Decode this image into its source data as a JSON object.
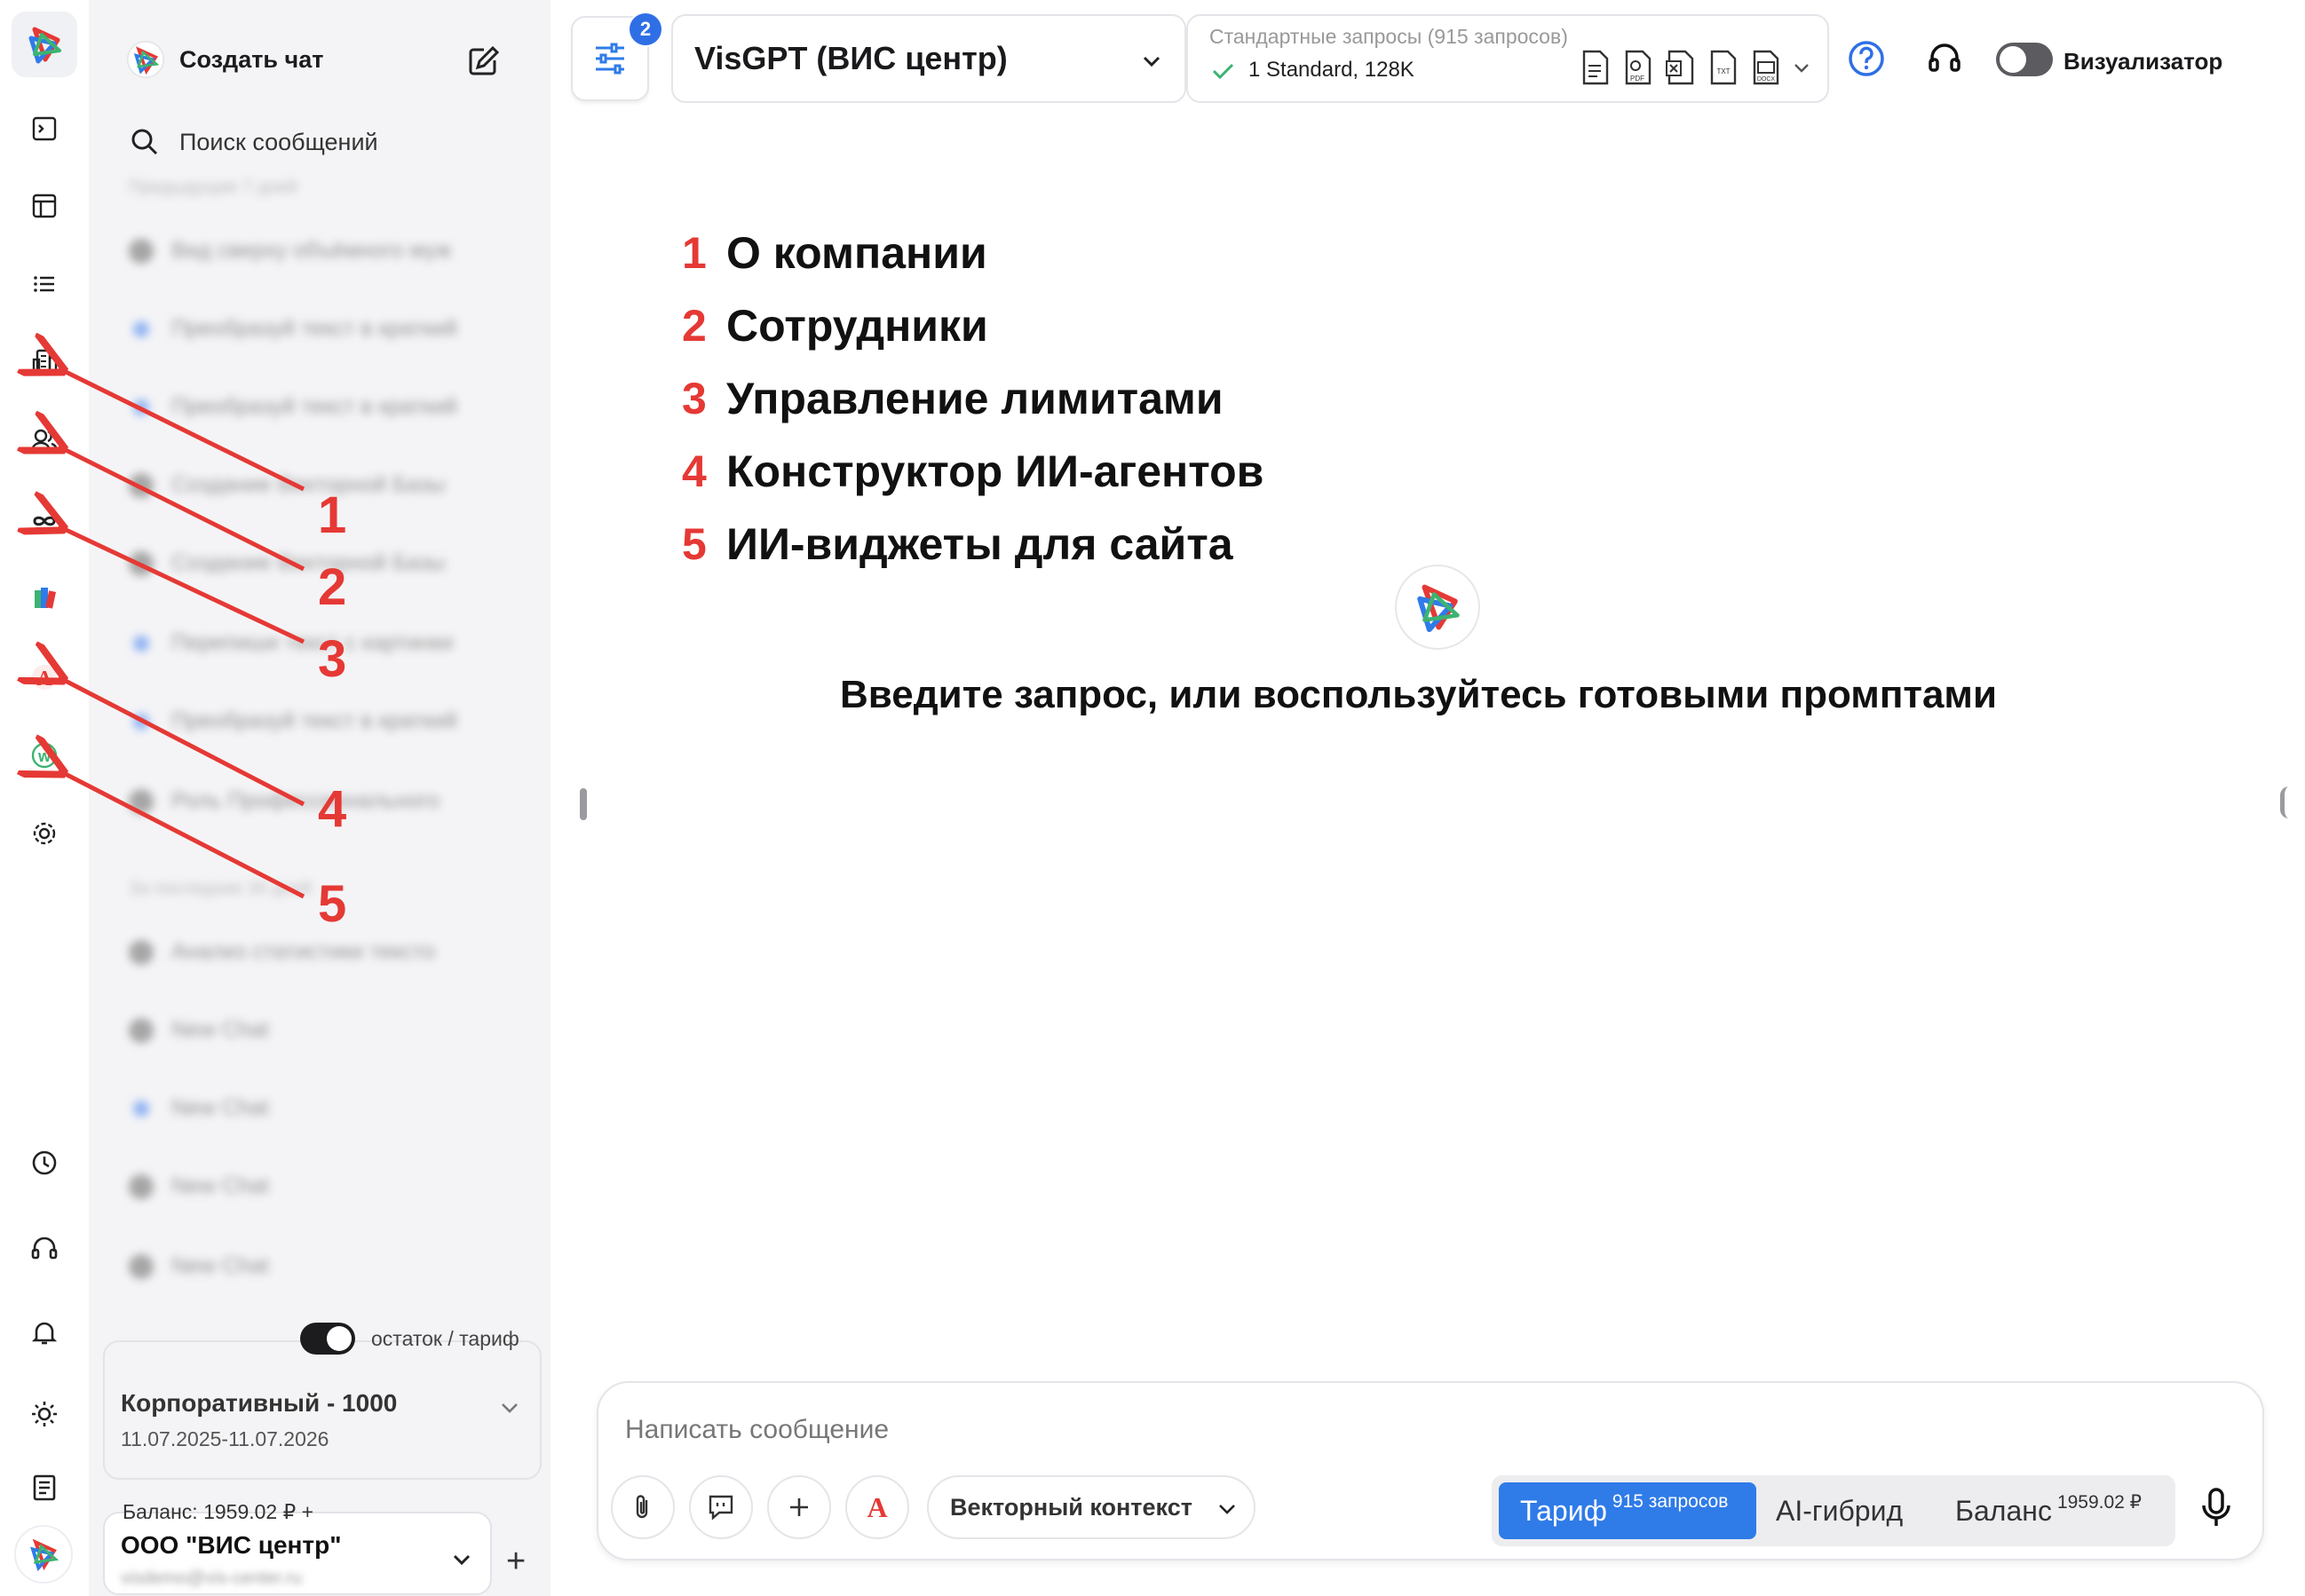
{
  "sidebar": {
    "new_chat": "Создать чат",
    "search": "Поиск сообщений",
    "group_previous": "Предыдущие 7 дней",
    "group_earlier": "За последние 30 дней",
    "chats": [
      "Вид сверху объёмного муж",
      "Преобразуй текст в краткий",
      "Преобразуй текст в краткий",
      "Создание Векторной Базы",
      "Создание Векторной Базы",
      "Перепиши текст с картинки",
      "Преобразуй текст в краткий",
      "Роль Профессионального",
      "Анализ статистики тексто",
      "New Chat",
      "New Chat",
      "New Chat",
      "New Chat"
    ],
    "toggle_label": "остаток / тариф",
    "tariff_name": "Корпоративный - 1000",
    "tariff_dates": "11.07.2025-11.07.2026",
    "balance": "Баланс: 1959.02 ₽ +",
    "org_name": "ООО \"ВИС центр\"",
    "org_email": "visdemo@vis-center.ru",
    "org_add": "+"
  },
  "topbar": {
    "badge": "2",
    "model": "VisGPT (ВИС центр)",
    "quota_title": "Стандартные запросы (915 запросов)",
    "quota_status": "1 Standard, 128K",
    "visualizer_label": "Визуализатор"
  },
  "annotations": [
    {
      "num": "1",
      "label": "О компании"
    },
    {
      "num": "2",
      "label": "Сотрудники"
    },
    {
      "num": "3",
      "label": "Управление лимитами"
    },
    {
      "num": "4",
      "label": "Конструктор ИИ-агентов"
    },
    {
      "num": "5",
      "label": "ИИ-виджеты для сайта"
    }
  ],
  "main": {
    "prompt_hint": "Введите запрос, или воспользуйтесь готовыми промптами"
  },
  "composer": {
    "placeholder": "Написать сообщение",
    "vector_context": "Векторный контекст",
    "mode_tariff": "Тариф",
    "mode_tariff_sup": "915 запросов",
    "mode_ai": "AI-гибрид",
    "mode_balance": "Баланс",
    "mode_balance_sup": "1959.02 ₽"
  },
  "colors": {
    "accent_blue": "#2f7be8",
    "annotation_red": "#e53935",
    "sidebar_bg": "#f4f4f6"
  }
}
